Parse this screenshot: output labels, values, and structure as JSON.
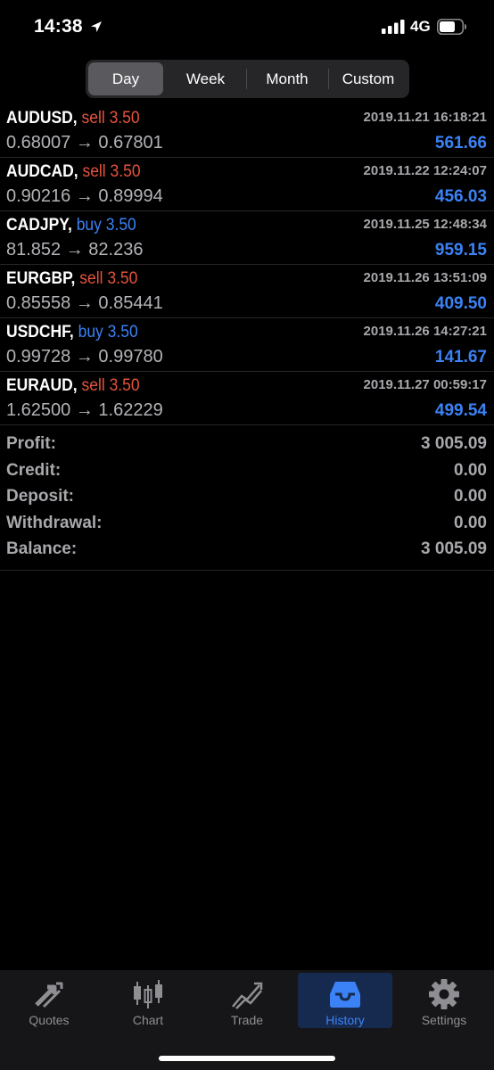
{
  "status_bar": {
    "time": "14:38",
    "network": "4G"
  },
  "period_tabs": [
    {
      "label": "Day",
      "active": true
    },
    {
      "label": "Week",
      "active": false
    },
    {
      "label": "Month",
      "active": false
    },
    {
      "label": "Custom",
      "active": false
    }
  ],
  "trades": [
    {
      "symbol": "AUDUSD,",
      "side": "sell",
      "volume": "3.50",
      "date": "2019.11.21 16:18:21",
      "prices": "0.68007 → 0.67801",
      "profit": "561.66"
    },
    {
      "symbol": "AUDCAD,",
      "side": "sell",
      "volume": "3.50",
      "date": "2019.11.22 12:24:07",
      "prices": "0.90216 → 0.89994",
      "profit": "456.03"
    },
    {
      "symbol": "CADJPY,",
      "side": "buy",
      "volume": "3.50",
      "date": "2019.11.25 12:48:34",
      "prices": "81.852 → 82.236",
      "profit": "959.15"
    },
    {
      "symbol": "EURGBP,",
      "side": "sell",
      "volume": "3.50",
      "date": "2019.11.26 13:51:09",
      "prices": "0.85558 → 0.85441",
      "profit": "409.50"
    },
    {
      "symbol": "USDCHF,",
      "side": "buy",
      "volume": "3.50",
      "date": "2019.11.26 14:27:21",
      "prices": "0.99728 → 0.99780",
      "profit": "141.67"
    },
    {
      "symbol": "EURAUD,",
      "side": "sell",
      "volume": "3.50",
      "date": "2019.11.27 00:59:17",
      "prices": "1.62500 → 1.62229",
      "profit": "499.54"
    }
  ],
  "summary": {
    "profit_label": "Profit:",
    "profit_value": "3 005.09",
    "credit_label": "Credit:",
    "credit_value": "0.00",
    "deposit_label": "Deposit:",
    "deposit_value": "0.00",
    "withdrawal_label": "Withdrawal:",
    "withdrawal_value": "0.00",
    "balance_label": "Balance:",
    "balance_value": "3 005.09"
  },
  "tabbar": [
    {
      "label": "Quotes",
      "icon": "quotes-arrows-icon",
      "active": false
    },
    {
      "label": "Chart",
      "icon": "candlestick-icon",
      "active": false
    },
    {
      "label": "Trade",
      "icon": "trade-chart-icon",
      "active": false
    },
    {
      "label": "History",
      "icon": "inbox-tray-icon",
      "active": true
    },
    {
      "label": "Settings",
      "icon": "gear-icon",
      "active": false
    }
  ],
  "colors": {
    "sell": "#e5533d",
    "buy": "#3b82f6",
    "profit": "#3b82f6",
    "active_tab": "#3b82f6",
    "background": "#000000"
  }
}
